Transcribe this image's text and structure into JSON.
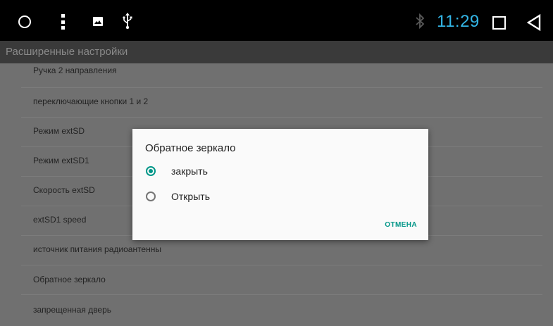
{
  "status_bar": {
    "time": "11:29",
    "time_color": "#33b5e5",
    "icons": [
      "home-circle-icon",
      "menu-kebab-icon",
      "photo-icon",
      "usb-icon",
      "bluetooth-icon",
      "recents-square-icon",
      "back-triangle-icon"
    ]
  },
  "title_bar": {
    "title": "Расширенные настройки"
  },
  "settings_list": {
    "items": [
      {
        "label": "Ручка 2 направления"
      },
      {
        "label": "переключающие кнопки 1 и 2"
      },
      {
        "label": "Режим extSD"
      },
      {
        "label": "Режим extSD1"
      },
      {
        "label": "Скорость extSD"
      },
      {
        "label": "extSD1 speed"
      },
      {
        "label": "источник питания радиоантенны"
      },
      {
        "label": "Обратное зеркало"
      },
      {
        "label": "запрещенная дверь"
      }
    ]
  },
  "dialog": {
    "title": "Обратное зеркало",
    "options": [
      {
        "label": "закрыть",
        "selected": true
      },
      {
        "label": "Открыть",
        "selected": false
      }
    ],
    "cancel_label": "ОТМЕНА",
    "accent_color": "#009688"
  }
}
